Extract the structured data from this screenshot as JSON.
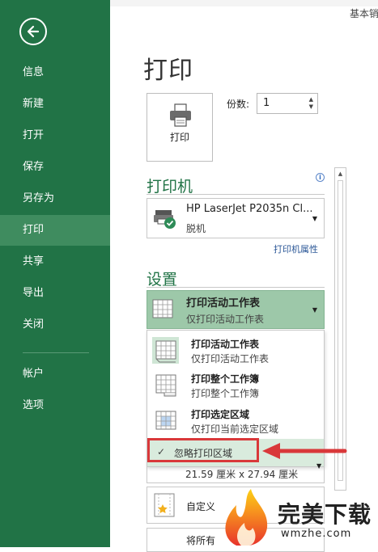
{
  "window": {
    "top_right_text": "基本销"
  },
  "sidebar": {
    "items": [
      {
        "label": "信息"
      },
      {
        "label": "新建"
      },
      {
        "label": "打开"
      },
      {
        "label": "保存"
      },
      {
        "label": "另存为"
      },
      {
        "label": "打印",
        "active": true
      },
      {
        "label": "共享"
      },
      {
        "label": "导出"
      },
      {
        "label": "关闭"
      },
      {
        "label": "帐户"
      },
      {
        "label": "选项"
      }
    ]
  },
  "main": {
    "title": "打印",
    "print_button": "打印",
    "copies": {
      "label": "份数:",
      "value": "1"
    },
    "printer": {
      "heading": "打印机",
      "name": "HP LaserJet P2035n Cl...",
      "status": "脱机",
      "properties_link": "打印机属性"
    },
    "settings": {
      "heading": "设置",
      "selected_title": "打印活动工作表",
      "selected_desc": "仅打印活动工作表",
      "options": [
        {
          "title": "打印活动工作表",
          "desc": "仅打印活动工作表"
        },
        {
          "title": "打印整个工作簿",
          "desc": "打印整个工作簿"
        },
        {
          "title": "打印选定区域",
          "desc": "仅打印当前选定区域"
        }
      ],
      "ignore_print_area": {
        "mark": "✓",
        "label": "忽略打印区域"
      },
      "paper_size": "21.59 厘米 x 27.94 厘米",
      "custom_label": "自定义",
      "bottom_label": "将所有"
    }
  },
  "watermark": {
    "title": "完美下载",
    "url": "wmzhe.com"
  },
  "colors": {
    "brand": "#217346",
    "active": "#3f8c5f",
    "highlight": "#d9383a"
  }
}
